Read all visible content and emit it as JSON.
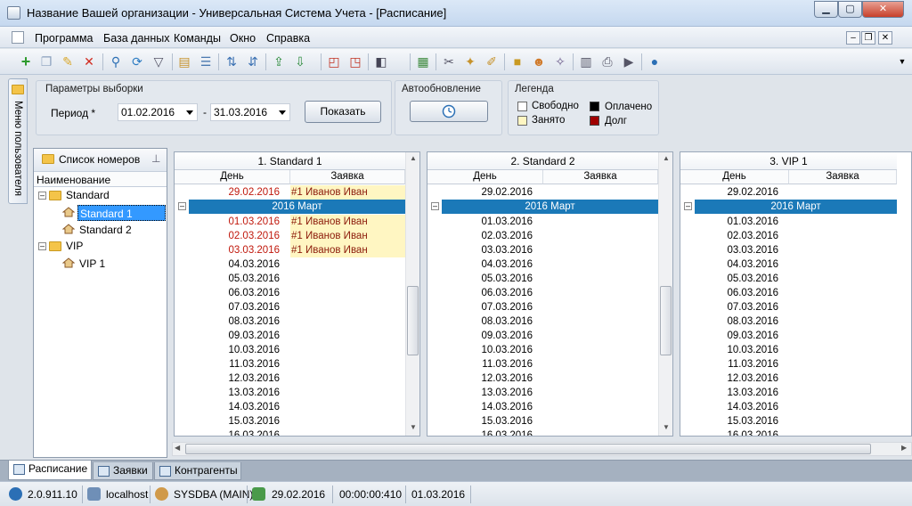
{
  "window": {
    "title": "Название Вашей организации - Универсальная Система Учета - [Расписание]",
    "minimize_glyph": "▁",
    "maximize_glyph": "▢",
    "close_glyph": "✕"
  },
  "menu": {
    "items": [
      "Программа",
      "База данных",
      "Команды",
      "Окно",
      "Справка"
    ],
    "mdi_buttons": [
      "–",
      "❐",
      "✕"
    ]
  },
  "toolbar": {
    "icons": [
      "add-icon",
      "copy-icon",
      "edit-icon",
      "delete-icon",
      "search-icon",
      "refresh-icon",
      "filter-icon",
      "group-icon",
      "comment-icon",
      "sort-icon",
      "export-icon",
      "import-icon",
      "new-window-icon",
      "close-window-icon",
      "print-setup-icon",
      "calendar-icon",
      "tools-icon",
      "wizard-icon",
      "report-icon",
      "lock-icon",
      "users-icon",
      "clean-icon",
      "table-icon",
      "printer-icon",
      "play-icon",
      "info-icon"
    ]
  },
  "side_tab": {
    "label": "Меню пользователя"
  },
  "filter": {
    "group_title": "Параметры выборки",
    "period_label": "Период *",
    "date_from": "01.02.2016",
    "separator": "-",
    "date_to": "31.03.2016",
    "show_button": "Показать"
  },
  "autoupdate": {
    "group_title": "Автообновление"
  },
  "legend": {
    "group_title": "Легенда",
    "items": [
      {
        "label": "Свободно",
        "color": "#ffffff"
      },
      {
        "label": "Занято",
        "color": "#fff6c2"
      },
      {
        "label": "Оплачено",
        "color": "#000000"
      },
      {
        "label": "Долг",
        "color": "#a00000"
      }
    ]
  },
  "room_list": {
    "header": "Список номеров",
    "column": "Наименование",
    "tree": [
      {
        "label": "Standard",
        "children": [
          "Standard 1",
          "Standard 2"
        ]
      },
      {
        "label": "VIP",
        "children": [
          "VIP 1"
        ]
      }
    ],
    "selected": "Standard 1",
    "expanded_glyph": "–"
  },
  "schedule": {
    "col_day": "День",
    "col_booking": "Заявка",
    "month_label": "2016 Март",
    "collapse_glyph": "–",
    "panels": [
      {
        "title": "1. Standard 1",
        "before_month": [
          {
            "day": "29.02.2016",
            "booking": "#1 Иванов Иван",
            "red": true
          }
        ],
        "rows": [
          {
            "day": "01.03.2016",
            "booking": "#1 Иванов Иван",
            "red": true
          },
          {
            "day": "02.03.2016",
            "booking": "#1 Иванов Иван",
            "red": true
          },
          {
            "day": "03.03.2016",
            "booking": "#1 Иванов Иван",
            "red": true
          },
          {
            "day": "04.03.2016",
            "booking": ""
          },
          {
            "day": "05.03.2016",
            "booking": ""
          },
          {
            "day": "06.03.2016",
            "booking": ""
          },
          {
            "day": "07.03.2016",
            "booking": ""
          },
          {
            "day": "08.03.2016",
            "booking": ""
          },
          {
            "day": "09.03.2016",
            "booking": ""
          },
          {
            "day": "10.03.2016",
            "booking": ""
          },
          {
            "day": "11.03.2016",
            "booking": ""
          },
          {
            "day": "12.03.2016",
            "booking": ""
          },
          {
            "day": "13.03.2016",
            "booking": ""
          },
          {
            "day": "14.03.2016",
            "booking": ""
          },
          {
            "day": "15.03.2016",
            "booking": ""
          },
          {
            "day": "16.03.2016",
            "booking": ""
          }
        ]
      },
      {
        "title": "2. Standard 2",
        "before_month": [
          {
            "day": "29.02.2016",
            "booking": ""
          }
        ],
        "rows": [
          {
            "day": "01.03.2016",
            "booking": ""
          },
          {
            "day": "02.03.2016",
            "booking": ""
          },
          {
            "day": "03.03.2016",
            "booking": ""
          },
          {
            "day": "04.03.2016",
            "booking": ""
          },
          {
            "day": "05.03.2016",
            "booking": ""
          },
          {
            "day": "06.03.2016",
            "booking": ""
          },
          {
            "day": "07.03.2016",
            "booking": ""
          },
          {
            "day": "08.03.2016",
            "booking": ""
          },
          {
            "day": "09.03.2016",
            "booking": ""
          },
          {
            "day": "10.03.2016",
            "booking": ""
          },
          {
            "day": "11.03.2016",
            "booking": ""
          },
          {
            "day": "12.03.2016",
            "booking": ""
          },
          {
            "day": "13.03.2016",
            "booking": ""
          },
          {
            "day": "14.03.2016",
            "booking": ""
          },
          {
            "day": "15.03.2016",
            "booking": ""
          },
          {
            "day": "16.03.2016",
            "booking": ""
          }
        ]
      },
      {
        "title": "3. VIP 1",
        "before_month": [
          {
            "day": "29.02.2016",
            "booking": ""
          }
        ],
        "rows": [
          {
            "day": "01.03.2016",
            "booking": ""
          },
          {
            "day": "02.03.2016",
            "booking": ""
          },
          {
            "day": "03.03.2016",
            "booking": ""
          },
          {
            "day": "04.03.2016",
            "booking": ""
          },
          {
            "day": "05.03.2016",
            "booking": ""
          },
          {
            "day": "06.03.2016",
            "booking": ""
          },
          {
            "day": "07.03.2016",
            "booking": ""
          },
          {
            "day": "08.03.2016",
            "booking": ""
          },
          {
            "day": "09.03.2016",
            "booking": ""
          },
          {
            "day": "10.03.2016",
            "booking": ""
          },
          {
            "day": "11.03.2016",
            "booking": ""
          },
          {
            "day": "12.03.2016",
            "booking": ""
          },
          {
            "day": "13.03.2016",
            "booking": ""
          },
          {
            "day": "14.03.2016",
            "booking": ""
          },
          {
            "day": "15.03.2016",
            "booking": ""
          },
          {
            "day": "16.03.2016",
            "booking": ""
          }
        ]
      }
    ]
  },
  "tabs": [
    "Расписание",
    "Заявки",
    "Контрагенты"
  ],
  "status": {
    "version": "2.0.911.10",
    "server": "localhost",
    "user": "SYSDBA (MAIN)",
    "date": "29.02.2016",
    "timer": "00:00:00:410",
    "date2": "01.03.2016"
  },
  "colors": {
    "month_row": "#1b79b8",
    "booked": "#fff6c2",
    "selection": "#3399ff"
  }
}
